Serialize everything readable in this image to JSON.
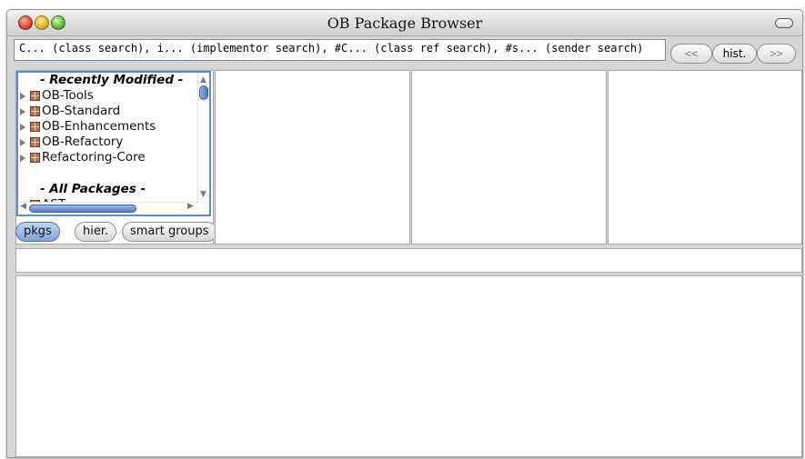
{
  "window": {
    "title": "OB Package Browser"
  },
  "search": {
    "text": "C... (class search), i... (implementor search), #C... (class ref search), #s... (sender search)"
  },
  "nav": {
    "prev_label": "<<",
    "hist_label": "hist.",
    "next_label": ">>"
  },
  "package_list": {
    "recent_header": "- Recently Modified -",
    "recent_items": [
      {
        "label": "OB-Tools"
      },
      {
        "label": "OB-Standard"
      },
      {
        "label": "OB-Enhancements"
      },
      {
        "label": "OB-Refactory"
      },
      {
        "label": "Refactoring-Core"
      }
    ],
    "all_header": "- All Packages -",
    "partial_item": "AST"
  },
  "tabs": [
    {
      "label": "pkgs",
      "selected": true
    },
    {
      "label": "hier.",
      "selected": false
    },
    {
      "label": "smart groups",
      "selected": false
    }
  ],
  "colors": {
    "selection_blue": "#5b8fd4",
    "window_gray": "#d6d6d6"
  }
}
